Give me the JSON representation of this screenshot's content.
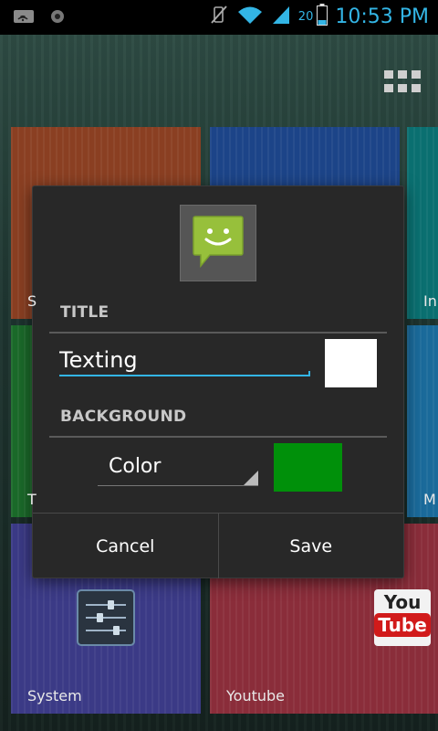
{
  "status_bar": {
    "time": "10:53 PM",
    "battery_level": "20",
    "icons": [
      "wifi-notification-icon",
      "sync-notification-icon",
      "vibrate-muted-icon",
      "wifi-signal-icon",
      "cell-signal-icon",
      "battery-icon"
    ]
  },
  "home": {
    "tiles": [
      {
        "label": "System",
        "color": "#3b3a86"
      },
      {
        "label": "Youtube",
        "color": "#8a2d3a"
      }
    ],
    "partial_labels": [
      "S",
      "In",
      "T",
      "M"
    ],
    "tile_colors": [
      "#8a3f22",
      "#1c4488",
      "#0a6f70",
      "#1b6a2a",
      "#1a6a9a"
    ],
    "youtube_logo_text": {
      "top": "You",
      "bottom": "Tube"
    }
  },
  "dialog": {
    "app_icon": "messaging-smiley-icon",
    "title_section_label": "TITLE",
    "title_value": "Texting",
    "title_color": "#ffffff",
    "background_section_label": "BACKGROUND",
    "background_mode": "Color",
    "background_color": "#00900a",
    "cancel_label": "Cancel",
    "save_label": "Save"
  },
  "colors": {
    "accent": "#33b5e5",
    "dialog_bg": "#282828"
  }
}
